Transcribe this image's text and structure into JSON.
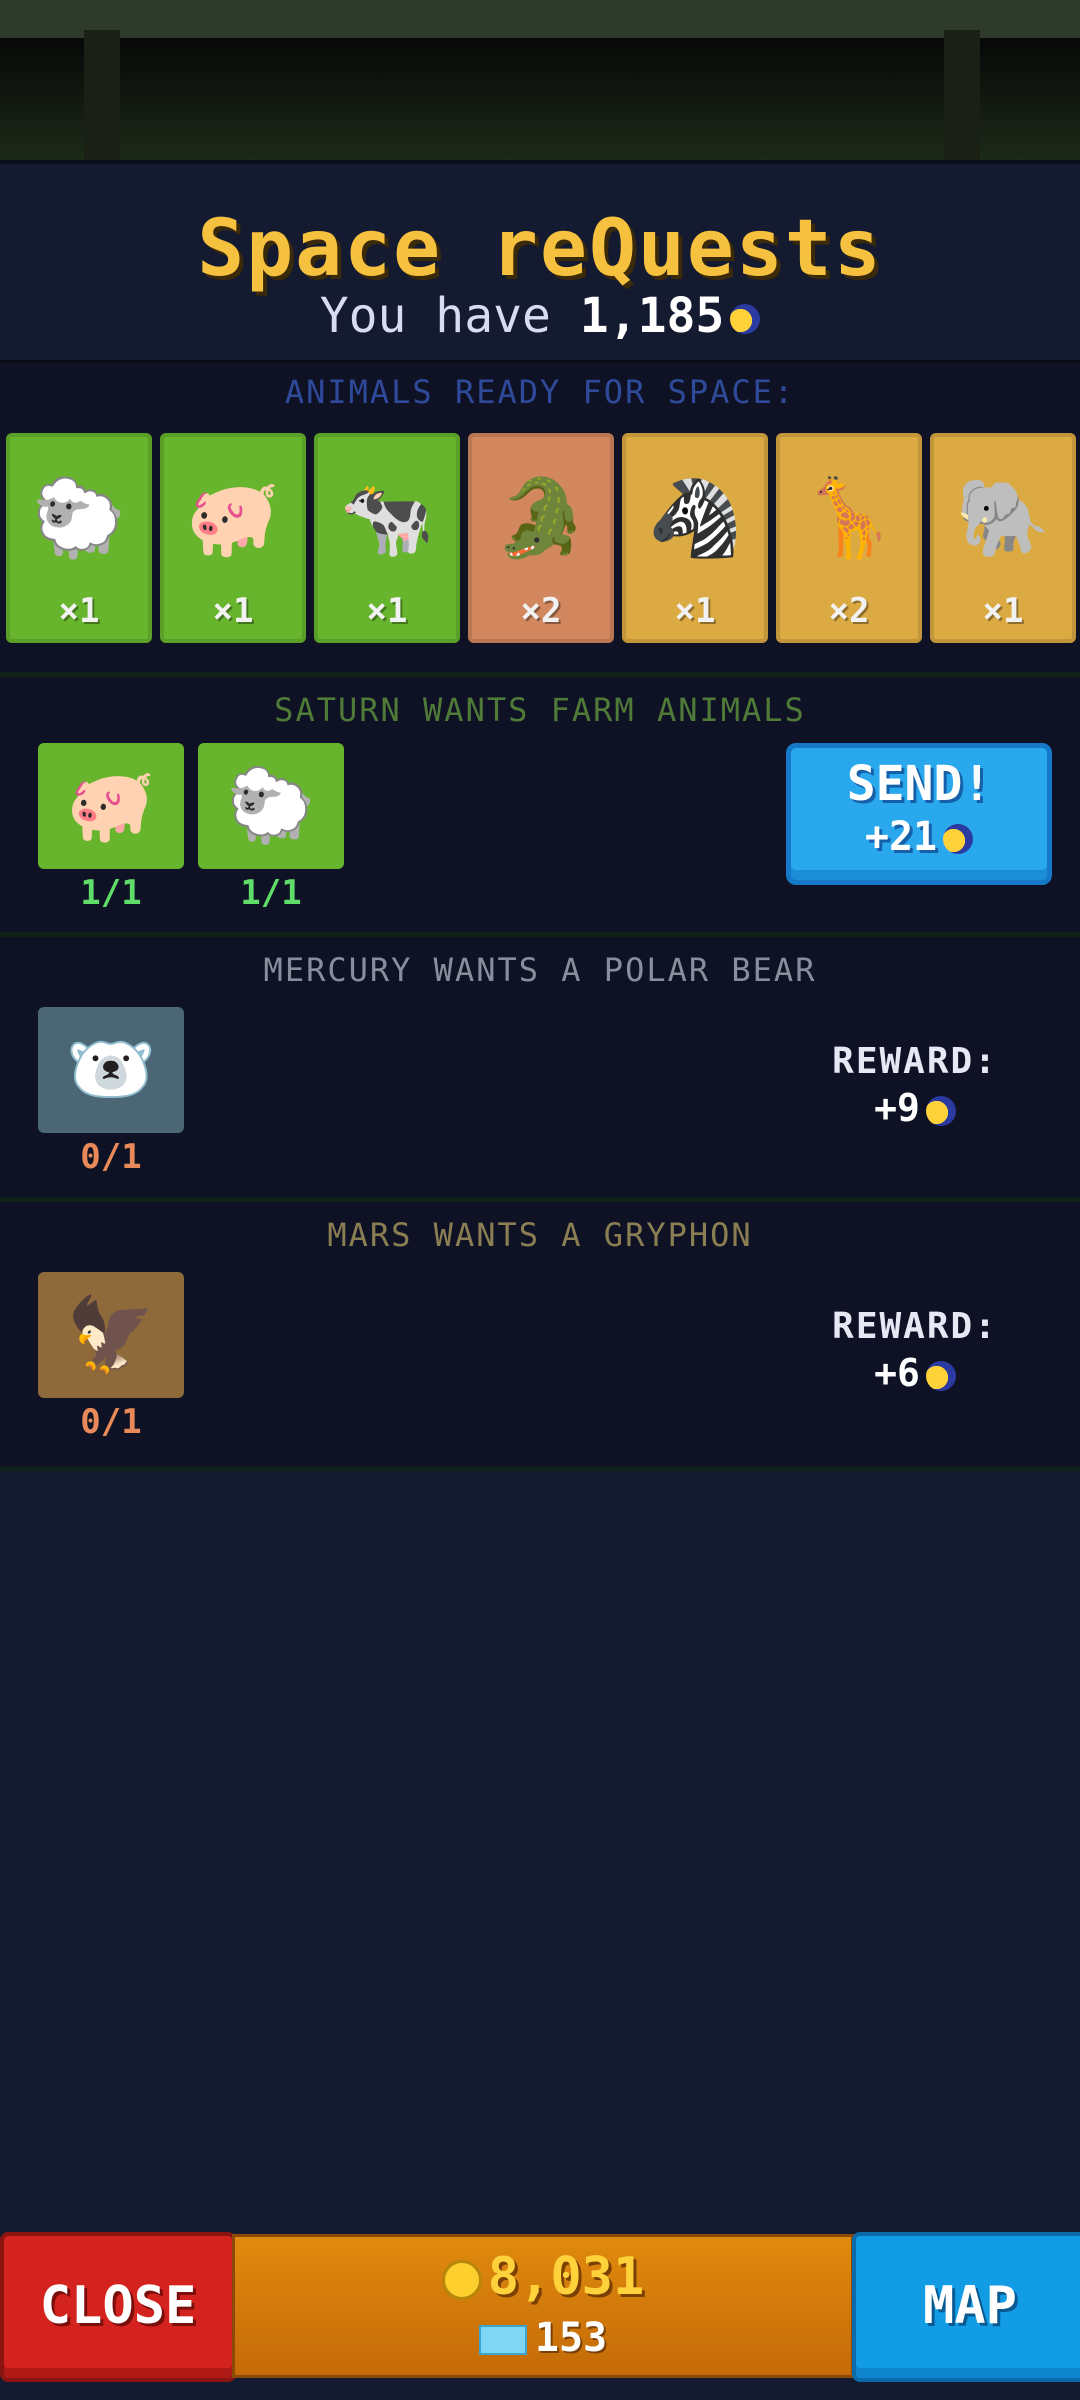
{
  "header": {
    "title": "Space reQuests",
    "balance_prefix": "You have",
    "balance_value": "1,185",
    "balance_icon": "moon-token-icon"
  },
  "ready": {
    "title": "ANIMALS READY FOR SPACE:",
    "animals": [
      {
        "name": "sheep",
        "glyph": "🐑",
        "count": "×1",
        "tile": "green"
      },
      {
        "name": "pig",
        "glyph": "🐖",
        "count": "×1",
        "tile": "green"
      },
      {
        "name": "cow",
        "glyph": "🐄",
        "count": "×1",
        "tile": "green"
      },
      {
        "name": "crocodile",
        "glyph": "🐊",
        "count": "×2",
        "tile": "clay"
      },
      {
        "name": "zebra",
        "glyph": "🦓",
        "count": "×1",
        "tile": "gold"
      },
      {
        "name": "giraffe",
        "glyph": "🦒",
        "count": "×2",
        "tile": "gold"
      },
      {
        "name": "elephant",
        "glyph": "🐘",
        "count": "×1",
        "tile": "gold"
      }
    ]
  },
  "quests": [
    {
      "title": "SATURN WANTS FARM ANIMALS",
      "title_color": "#4f7a38",
      "requirements": [
        {
          "name": "pig",
          "glyph": "🐖",
          "progress": "1/1",
          "progress_color": "#5fdc6a",
          "tile_color": "#67b52d"
        },
        {
          "name": "sheep",
          "glyph": "🐑",
          "progress": "1/1",
          "progress_color": "#5fdc6a",
          "tile_color": "#67b52d"
        }
      ],
      "send_label": "SEND!",
      "send_reward": "+21"
    },
    {
      "title": "MERCURY WANTS A POLAR BEAR",
      "title_color": "#8a8e9c",
      "requirements": [
        {
          "name": "polar-bear",
          "glyph": "🐻‍❄️",
          "progress": "0/1",
          "progress_color": "#e8895a",
          "tile_color": "#4b6674"
        }
      ],
      "reward_label": "REWARD:",
      "reward_value": "+9"
    },
    {
      "title": "MARS WANTS A GRYPHON",
      "title_color": "#8a7e52",
      "requirements": [
        {
          "name": "gryphon",
          "glyph": "🦅",
          "progress": "0/1",
          "progress_color": "#e8895a",
          "tile_color": "#8e6a3a"
        }
      ],
      "reward_label": "REWARD:",
      "reward_value": "+6"
    }
  ],
  "bottom": {
    "close_label": "CLOSE",
    "coins": "8,031",
    "coin_icon": "coin-icon",
    "tickets": "153",
    "ticket_icon": "ticket-icon",
    "map_label": "MAP"
  }
}
